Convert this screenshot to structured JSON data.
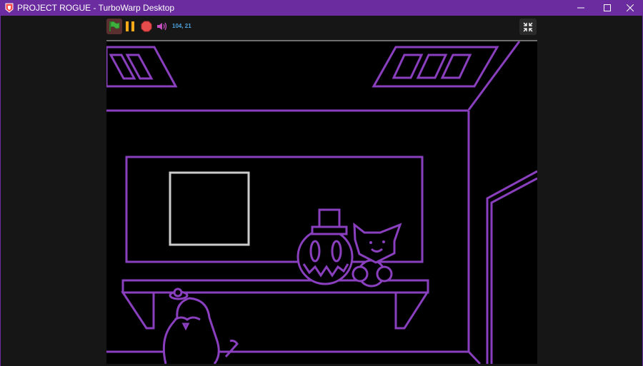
{
  "window": {
    "title": "PROJECT ROGUE - TurboWarp Desktop",
    "app_icon": "turbowarp-logo-icon",
    "controls": [
      "minimize-icon",
      "maximize-icon",
      "close-icon"
    ]
  },
  "toolbar": {
    "buttons": [
      "green-flag-icon",
      "pause-icon",
      "stop-icon",
      "volume-icon"
    ],
    "mouse_coordinates": "104, 21",
    "fullscreen_button": "exit-fullscreen-icon"
  },
  "colors": {
    "titlebar": "#6a2c9e",
    "scene_line": "#8a3fbf",
    "window_frame": "#cccccc",
    "flag": "#3fb13f",
    "pause": "#ffab19",
    "stop": "#e74c4c",
    "volume": "#c64fbf",
    "coordinates_text": "#4ba3e0"
  },
  "scene": {
    "description_icons": [
      "ceiling-vent-icon",
      "wall-frame-icon",
      "window-icon",
      "shelf-icon",
      "tophat-plush-icon",
      "cat-plush-icon",
      "penguin-plush-icon",
      "doorway-icon"
    ]
  }
}
